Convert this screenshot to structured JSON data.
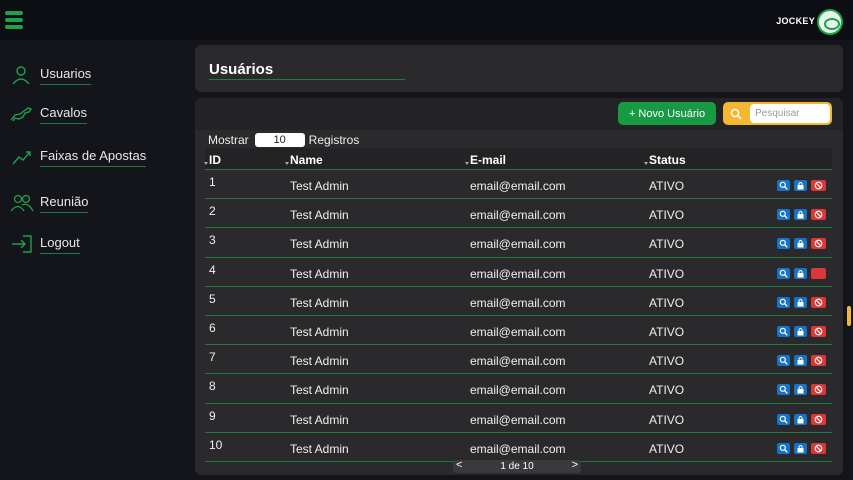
{
  "header": {
    "brand": "JOCKEY",
    "menu_icon": "hamburger-icon",
    "logo_icon": "jockey-logo"
  },
  "sidebar": {
    "items": [
      {
        "label": "Usuarios",
        "icon": "user-icon"
      },
      {
        "label": "Cavalos",
        "icon": "horse-icon"
      },
      {
        "label": "Faixas de Apostas",
        "icon": "trend-icon"
      },
      {
        "label": "Reunião",
        "icon": "group-icon"
      },
      {
        "label": "Logout",
        "icon": "logout-icon"
      }
    ]
  },
  "page": {
    "title": "Usuários",
    "new_button": "+ Novo Usuário",
    "search_placeholder": "Pesquisar",
    "show_label": "Mostrar",
    "page_size": "10",
    "records_label": "Registros"
  },
  "table": {
    "columns": [
      "ID",
      "Name",
      "E-mail",
      "Status"
    ],
    "rows": [
      {
        "id": "1",
        "name": "Test Admin",
        "email": "email@email.com",
        "status": "ATIVO"
      },
      {
        "id": "2",
        "name": "Test Admin",
        "email": "email@email.com",
        "status": "ATIVO"
      },
      {
        "id": "3",
        "name": "Test Admin",
        "email": "email@email.com",
        "status": "ATIVO"
      },
      {
        "id": "4",
        "name": "Test Admin",
        "email": "email@email.com",
        "status": "ATIVO"
      },
      {
        "id": "5",
        "name": "Test Admin",
        "email": "email@email.com",
        "status": "ATIVO"
      },
      {
        "id": "6",
        "name": "Test Admin",
        "email": "email@email.com",
        "status": "ATIVO"
      },
      {
        "id": "7",
        "name": "Test Admin",
        "email": "email@email.com",
        "status": "ATIVO"
      },
      {
        "id": "8",
        "name": "Test Admin",
        "email": "email@email.com",
        "status": "ATIVO"
      },
      {
        "id": "9",
        "name": "Test Admin",
        "email": "email@email.com",
        "status": "ATIVO"
      },
      {
        "id": "10",
        "name": "Test Admin",
        "email": "email@email.com",
        "status": "ATIVO"
      }
    ]
  },
  "pagination": {
    "prev": "<",
    "info": "1 de 10",
    "next": ">"
  },
  "colors": {
    "accent_green": "#189a45",
    "search_yellow": "#f4b733",
    "action_blue": "#1673c8",
    "action_red": "#d93838"
  }
}
